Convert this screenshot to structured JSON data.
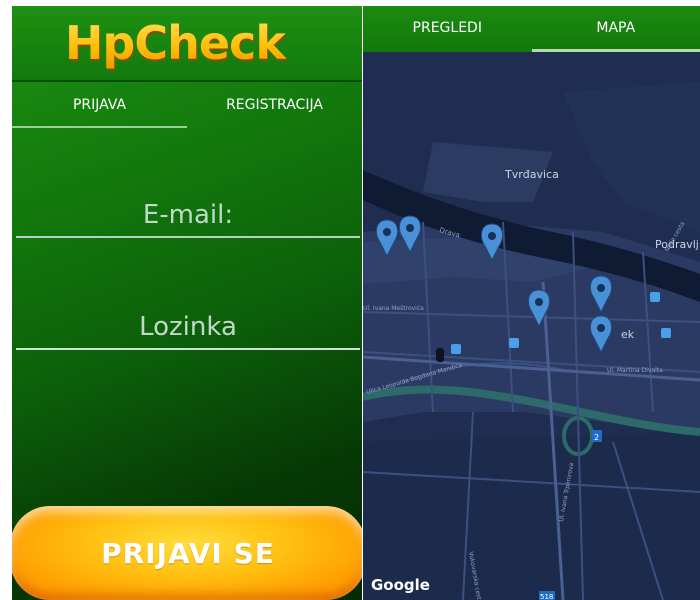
{
  "login": {
    "logo_text": "HpCheck",
    "logo_plus": "+",
    "tabs": [
      "PRIJAVA",
      "REGISTRACIJA"
    ],
    "active_tab": 0,
    "email_placeholder": "E-mail:",
    "password_placeholder": "Lozinka",
    "submit_label": "PRIJAVI SE"
  },
  "map_screen": {
    "tabs": [
      "PREGLEDI",
      "MAPA"
    ],
    "active_tab": 1,
    "labels": {
      "tvrdavica": "Tvrđavica",
      "podravlj": "Podravlj",
      "drava": "Drava",
      "ek": "ek",
      "martina": "Ul. Martina Divalta",
      "leopolda": "Ulica Leopolda Bogdana Mandića",
      "ivana": "Ul. Ivana Meštrovića",
      "vukovarska": "Vukovarska cesta",
      "ul_vi": "Ul. Ivana Trpimirova",
      "route2": "2",
      "route518": "518",
      "nolje": "Nolje cesta",
      "google": "Google"
    },
    "markers_count": 6
  },
  "colors": {
    "green_dark": "#0c5f0a",
    "accent_orange": "#ffb000",
    "map_bg": "#1d2d4e",
    "marker": "#4a90d6"
  }
}
